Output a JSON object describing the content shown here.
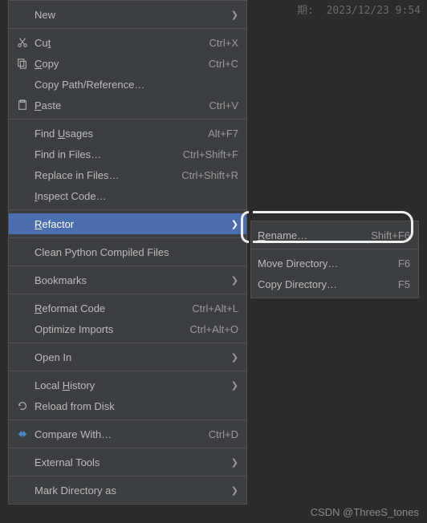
{
  "header": {
    "timestamp_label": "期:",
    "timestamp_value": "2023/12/23 9:54"
  },
  "menu": {
    "new": {
      "label": "New",
      "shortcut": "",
      "submenu": true
    },
    "cut": {
      "label": "Cut",
      "shortcut": "Ctrl+X",
      "submenu": false,
      "mnemonic": "t"
    },
    "copy": {
      "label": "Copy",
      "shortcut": "Ctrl+C",
      "submenu": false,
      "mnemonic": "C"
    },
    "copy_path": {
      "label": "Copy Path/Reference…",
      "shortcut": "",
      "submenu": false
    },
    "paste": {
      "label": "Paste",
      "shortcut": "Ctrl+V",
      "submenu": false,
      "mnemonic": "P"
    },
    "find_usages": {
      "label": "Find Usages",
      "shortcut": "Alt+F7",
      "submenu": false,
      "mnemonic": "U"
    },
    "find_in_files": {
      "label": "Find in Files…",
      "shortcut": "Ctrl+Shift+F",
      "submenu": false
    },
    "replace_files": {
      "label": "Replace in Files…",
      "shortcut": "Ctrl+Shift+R",
      "submenu": false
    },
    "inspect_code": {
      "label": "Inspect Code…",
      "shortcut": "",
      "submenu": false,
      "mnemonic": "I"
    },
    "refactor": {
      "label": "Refactor",
      "shortcut": "",
      "submenu": true,
      "mnemonic": "R",
      "selected": true
    },
    "clean_python": {
      "label": "Clean Python Compiled Files",
      "shortcut": "",
      "submenu": false
    },
    "bookmarks": {
      "label": "Bookmarks",
      "shortcut": "",
      "submenu": true
    },
    "reformat": {
      "label": "Reformat Code",
      "shortcut": "Ctrl+Alt+L",
      "submenu": false,
      "mnemonic": "R"
    },
    "optimize": {
      "label": "Optimize Imports",
      "shortcut": "Ctrl+Alt+O",
      "submenu": false
    },
    "open_in": {
      "label": "Open In",
      "shortcut": "",
      "submenu": true
    },
    "local_history": {
      "label": "Local History",
      "shortcut": "",
      "submenu": true,
      "mnemonic": "H"
    },
    "reload": {
      "label": "Reload from Disk",
      "shortcut": "",
      "submenu": false
    },
    "compare": {
      "label": "Compare With…",
      "shortcut": "Ctrl+D",
      "submenu": false
    },
    "ext_tools": {
      "label": "External Tools",
      "shortcut": "",
      "submenu": true
    },
    "mark_dir": {
      "label": "Mark Directory as",
      "shortcut": "",
      "submenu": true
    }
  },
  "submenu": {
    "rename": {
      "label": "Rename…",
      "shortcut": "Shift+F6",
      "mnemonic": "R"
    },
    "move_dir": {
      "label": "Move Directory…",
      "shortcut": "F6"
    },
    "copy_dir": {
      "label": "Copy Directory…",
      "shortcut": "F5"
    }
  },
  "watermark": "CSDN @ThreeS_tones"
}
